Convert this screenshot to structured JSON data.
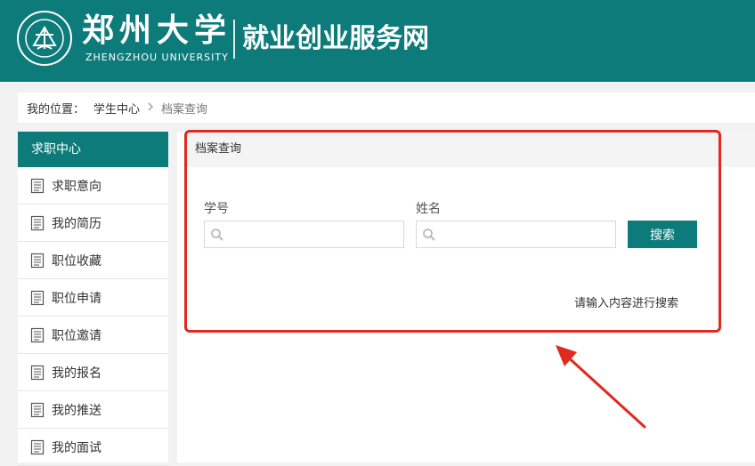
{
  "header": {
    "logo_cn": "郑州大学",
    "logo_en": "ZHENGZHOU UNIVERSITY",
    "site_title": "就业创业服务网",
    "bg_color": "#0e7b7b"
  },
  "breadcrumb": {
    "label": "我的位置：",
    "parent": "学生中心",
    "separator_icon": "chevron-right-icon",
    "current": "档案查询"
  },
  "sidebar": {
    "title": "求职中心",
    "item_icon": "document-list-icon",
    "items": [
      {
        "label": "求职意向"
      },
      {
        "label": "我的简历"
      },
      {
        "label": "职位收藏"
      },
      {
        "label": "职位申请"
      },
      {
        "label": "职位邀请"
      },
      {
        "label": "我的报名"
      },
      {
        "label": "我的推送"
      },
      {
        "label": "我的面试"
      }
    ]
  },
  "panel": {
    "title": "档案查询",
    "student_id_label": "学号",
    "student_id_value": "",
    "name_label": "姓名",
    "name_value": "",
    "search_icon": "search-icon",
    "search_button": "搜索",
    "hint": "请输入内容进行搜索"
  },
  "annotation": {
    "highlight_color": "#e02a1f"
  }
}
